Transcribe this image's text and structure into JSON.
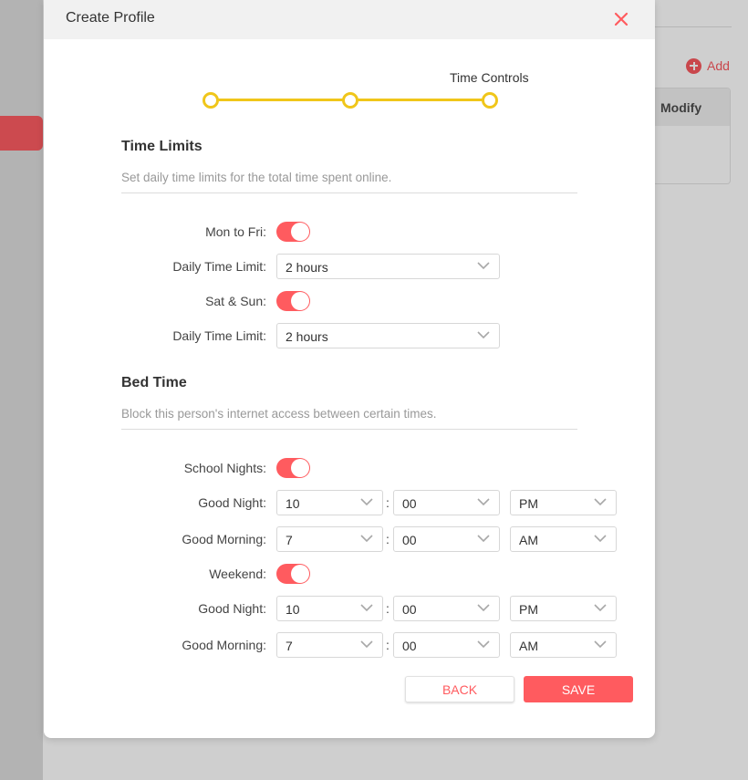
{
  "background": {
    "add_label": "Add",
    "table_header": "Modify"
  },
  "modal": {
    "title": "Create Profile",
    "step_label": "Time Controls"
  },
  "time_limits": {
    "title": "Time Limits",
    "description": "Set daily time limits for the total time spent online.",
    "mon_fri_label": "Mon to Fri:",
    "mon_fri_enabled": true,
    "mon_fri_limit_label": "Daily Time Limit:",
    "mon_fri_limit_value": "2 hours",
    "sat_sun_label": "Sat & Sun:",
    "sat_sun_enabled": true,
    "sat_sun_limit_label": "Daily Time Limit:",
    "sat_sun_limit_value": "2 hours"
  },
  "bed_time": {
    "title": "Bed Time",
    "description": "Block this person's internet access between certain times.",
    "school_nights": {
      "label": "School Nights:",
      "enabled": true,
      "good_night": {
        "label": "Good Night:",
        "hour": "10",
        "minute": "00",
        "ampm": "PM"
      },
      "good_morning": {
        "label": "Good Morning:",
        "hour": "7",
        "minute": "00",
        "ampm": "AM"
      }
    },
    "weekend": {
      "label": "Weekend:",
      "enabled": true,
      "good_night": {
        "label": "Good Night:",
        "hour": "10",
        "minute": "00",
        "ampm": "PM"
      },
      "good_morning": {
        "label": "Good Morning:",
        "hour": "7",
        "minute": "00",
        "ampm": "AM"
      }
    },
    "separator": ":"
  },
  "buttons": {
    "back": "BACK",
    "save": "SAVE"
  },
  "colors": {
    "accent": "#ff5b5f",
    "stepper": "#f0c61a"
  }
}
